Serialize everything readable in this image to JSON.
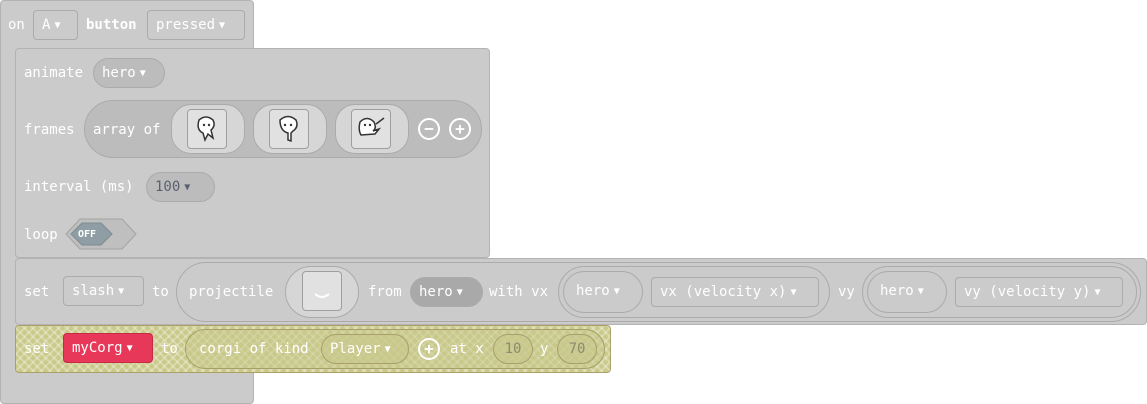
{
  "event": {
    "on_label": "on",
    "key_value": "A",
    "button_label": "button",
    "state_value": "pressed"
  },
  "animate": {
    "animate_label": "animate",
    "sprite_value": "hero",
    "frames_label": "frames",
    "array_of_label": "array of",
    "frame_images": [
      "hero-frame-1",
      "hero-frame-2",
      "hero-frame-3"
    ],
    "remove_icon": "minus-circle-icon",
    "add_icon": "plus-circle-icon",
    "interval_label": "interval (ms)",
    "interval_value": "100",
    "loop_label": "loop",
    "loop_value": "OFF"
  },
  "projectile_stmt": {
    "set_label": "set",
    "variable_value": "slash",
    "to_label": "to",
    "projectile_label": "projectile",
    "from_label": "from",
    "from_sprite": "hero",
    "with_vx_label": "with vx",
    "vx_sprite": "hero",
    "vx_property": "vx (velocity x)",
    "vy_label": "vy",
    "vy_sprite": "hero",
    "vy_property": "vy (velocity y)"
  },
  "corgi_stmt": {
    "set_label": "set",
    "variable_value": "myCorg",
    "to_label": "to",
    "corgi_label": "corgi of kind",
    "kind_value": "Player",
    "add_icon": "plus-circle-icon",
    "at_x_label": "at x",
    "x_value": "10",
    "y_label": "y",
    "y_value": "70"
  },
  "colors": {
    "disabled_block": "#cbcbcb",
    "disabled_border": "#b3b3b3",
    "variable_pink": "#e8385a",
    "corgi_hatch": "#c9c98a"
  }
}
